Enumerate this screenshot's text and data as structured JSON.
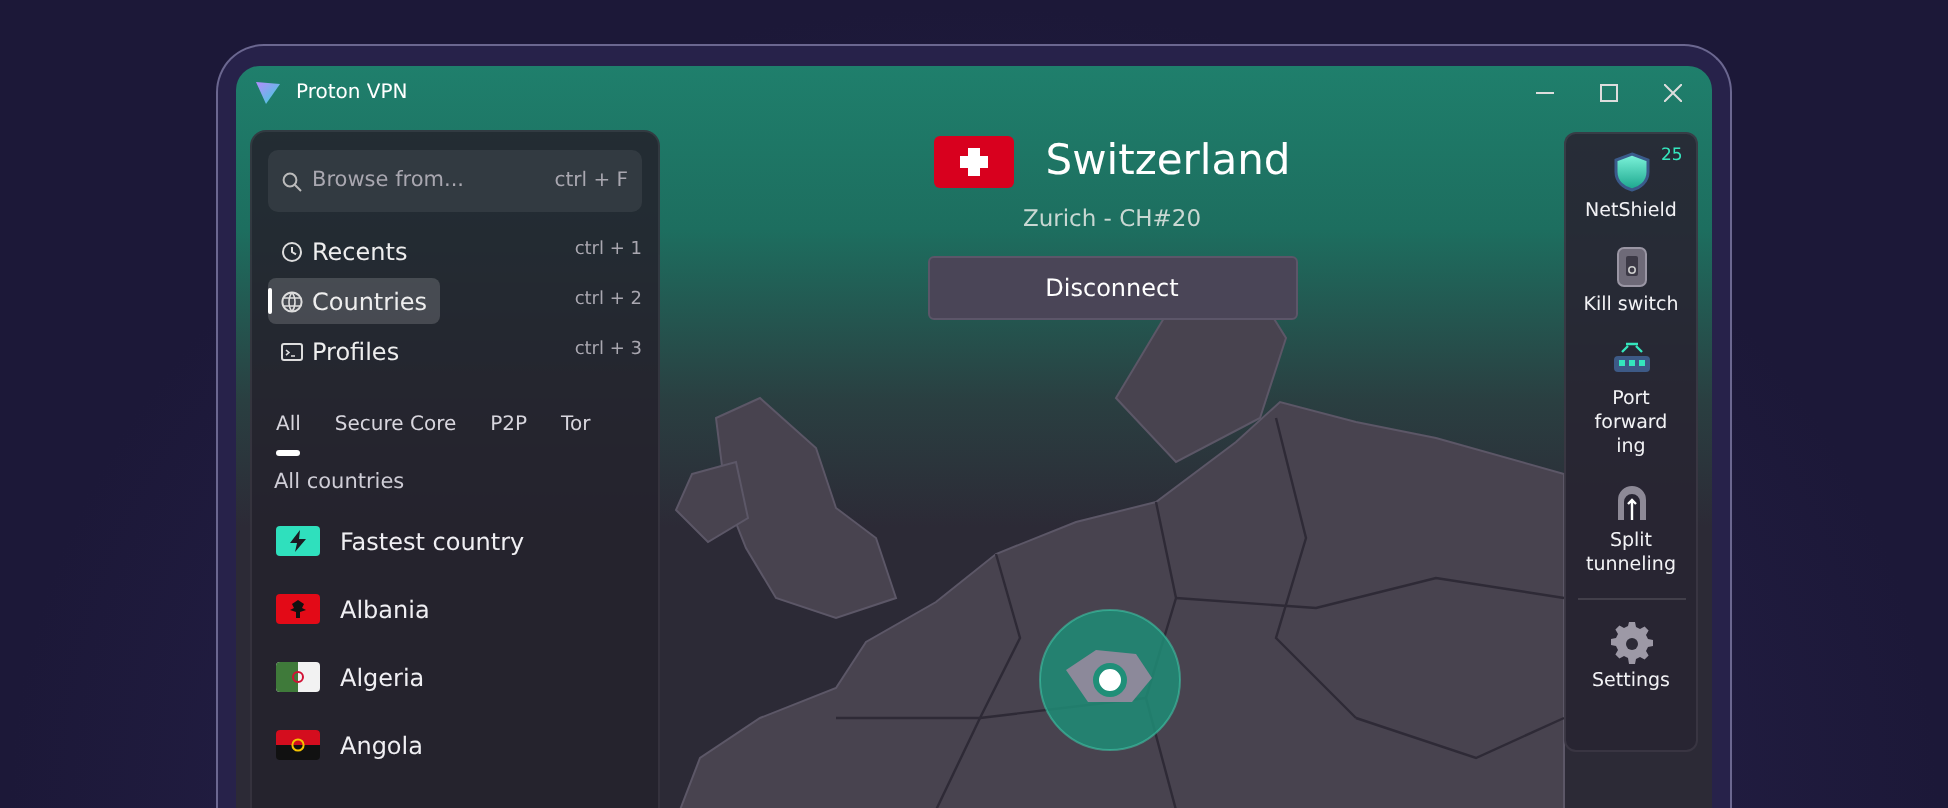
{
  "window": {
    "title": "Proton VPN"
  },
  "sidebar": {
    "search": {
      "placeholder": "Browse from...",
      "shortcut": "ctrl + F"
    },
    "nav": [
      {
        "kind": "recents",
        "label": "Recents",
        "shortcut": "ctrl + 1",
        "selected": false
      },
      {
        "kind": "countries",
        "label": "Countries",
        "shortcut": "ctrl + 2",
        "selected": true
      },
      {
        "kind": "profiles",
        "label": "Profiles",
        "shortcut": "ctrl + 3",
        "selected": false
      }
    ],
    "filters": [
      {
        "label": "All",
        "selected": true
      },
      {
        "label": "Secure Core",
        "selected": false
      },
      {
        "label": "P2P",
        "selected": false
      },
      {
        "label": "Tor",
        "selected": false
      }
    ],
    "section_title": "All countries",
    "countries": [
      {
        "kind": "fastest",
        "name": "Fastest country"
      },
      {
        "kind": "albania",
        "name": "Albania"
      },
      {
        "kind": "algeria",
        "name": "Algeria"
      },
      {
        "kind": "angola",
        "name": "Angola"
      }
    ]
  },
  "connection": {
    "country": "Switzerland",
    "server": "Zurich - CH#20",
    "button": "Disconnect"
  },
  "features": [
    {
      "kind": "netshield",
      "label": "NetShield",
      "badge": "25"
    },
    {
      "kind": "killswitch",
      "label": "Kill switch"
    },
    {
      "kind": "portforwarding",
      "label": "Port forward ing"
    },
    {
      "kind": "splittunneling",
      "label": "Split tunneling"
    },
    {
      "kind": "settings",
      "label": "Settings"
    }
  ]
}
